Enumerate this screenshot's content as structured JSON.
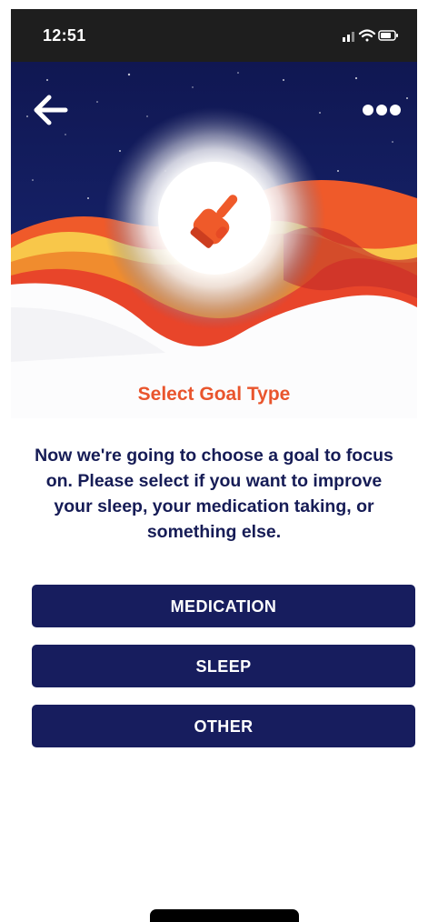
{
  "status_bar": {
    "time": "12:51",
    "icons": [
      "signal-icon",
      "wifi-icon",
      "battery-icon"
    ]
  },
  "header": {
    "back_icon": "arrow-left-icon",
    "more_icon": "more-dots-icon",
    "illustration_icon": "pointing-hand-icon",
    "title": "Select Goal Type"
  },
  "main": {
    "description": "Now we're going to choose a goal to focus on. Please select if you want to improve your sleep, your medication taking, or something else.",
    "options": [
      {
        "label": "MEDICATION"
      },
      {
        "label": "SLEEP"
      },
      {
        "label": "OTHER"
      }
    ]
  },
  "colors": {
    "night_sky": "#14195a",
    "accent_orange": "#e9552d",
    "button_navy": "#171d5e",
    "text_navy": "#161c56"
  }
}
